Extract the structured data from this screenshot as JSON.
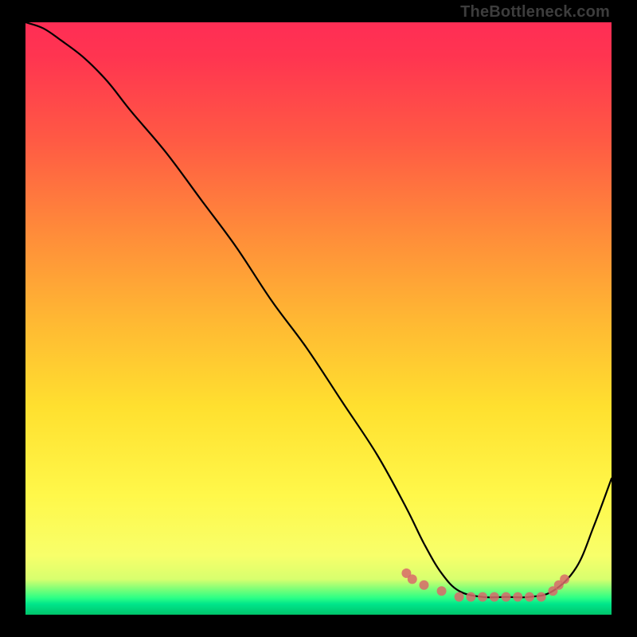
{
  "watermark": "TheBottleneck.com",
  "chart_data": {
    "type": "line",
    "title": "",
    "xlabel": "",
    "ylabel": "",
    "xlim": [
      0,
      100
    ],
    "ylim": [
      0,
      100
    ],
    "grid": false,
    "background_gradient": {
      "top": "#ff2d55",
      "mid": "#ffe02f",
      "bottom_band": "#2bff86"
    },
    "series": [
      {
        "name": "bottleneck-curve",
        "color": "#000000",
        "stroke_width": 2,
        "x": [
          0,
          3,
          6,
          10,
          14,
          18,
          24,
          30,
          36,
          42,
          48,
          54,
          60,
          65,
          68,
          71,
          74,
          78,
          82,
          86,
          90,
          94,
          97,
          100
        ],
        "values": [
          100,
          99,
          97,
          94,
          90,
          85,
          78,
          70,
          62,
          53,
          45,
          36,
          27,
          18,
          12,
          7,
          4,
          3,
          3,
          3,
          4,
          8,
          15,
          23
        ]
      },
      {
        "name": "sweet-spot-markers",
        "color": "#d86a6a",
        "marker": "circle",
        "marker_radius": 6,
        "x": [
          65,
          66,
          68,
          71,
          74,
          76,
          78,
          80,
          82,
          84,
          86,
          88,
          90,
          91,
          92
        ],
        "values": [
          7,
          6,
          5,
          4,
          3,
          3,
          3,
          3,
          3,
          3,
          3,
          3,
          4,
          5,
          6
        ]
      }
    ],
    "annotations": []
  }
}
